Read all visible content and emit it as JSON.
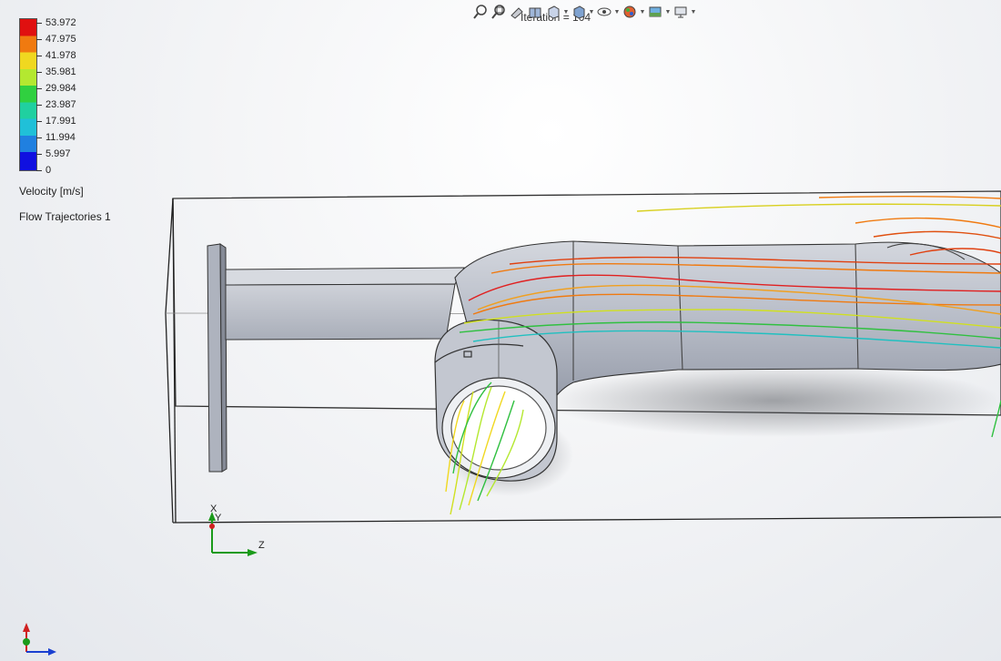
{
  "legend": {
    "ticks": [
      "53.972",
      "47.975",
      "41.978",
      "35.981",
      "29.984",
      "23.987",
      "17.991",
      "11.994",
      "5.997",
      "0"
    ],
    "quantity": "Velocity [m/s]",
    "plot_name": "Flow Trajectories 1"
  },
  "status": {
    "iteration": "Iteration = 104"
  },
  "toolbar": {
    "icons": [
      "zoom-to-fit-icon",
      "zoom-to-area-icon",
      "previous-view-icon",
      "section-view-icon",
      "view-orientation-icon",
      "display-style-icon",
      "hide-show-items-icon",
      "edit-appearance-icon",
      "apply-scene-icon",
      "view-settings-icon"
    ]
  },
  "triad": {
    "x_label": "X",
    "y_label": "Y",
    "z_label": "Z"
  },
  "colors": {
    "max": "#e01010",
    "high": "#f07a10",
    "mid_high": "#f0d820",
    "mid": "#30d040",
    "low": "#20c0d8",
    "min": "#1010e0",
    "model_fill": "#b9bec9",
    "axis_green": "#1a9a1a",
    "axis_blue": "#1a40d0"
  }
}
